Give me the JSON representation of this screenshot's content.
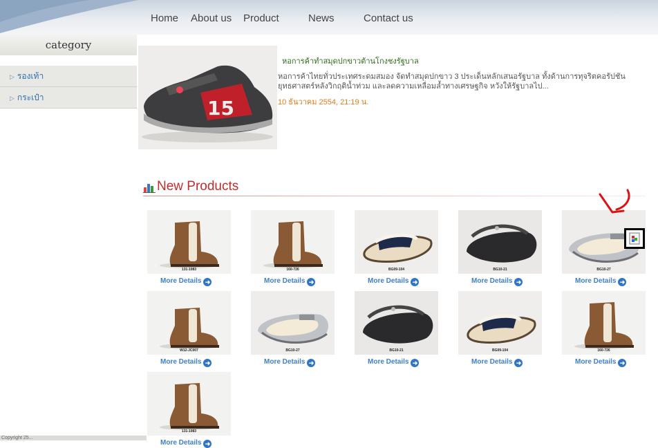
{
  "nav": {
    "home": "Home",
    "about": "About us",
    "product": "Product",
    "news": "News",
    "contact": "Contact us"
  },
  "sidebar": {
    "heading": "category",
    "items": [
      {
        "label": "รองเท้า"
      },
      {
        "label": "กระเป๋า"
      }
    ]
  },
  "news": {
    "title": "หอการค้าทำสมุดปกขาวต้านโกงชงรัฐบาล",
    "summary": "หอการค้าไทยทั่วประเทศระดมสมอง จัดทำสมุดปกขาว 3 ประเด็นหลักเสนอรัฐบาล ทั้งด้านการทุจริตคอรัปชัน ยุทธศาสตร์หลังวิกฤติน้ำท่วม และลดความเหลื่อมล้ำทางเศรษฐกิจ หวังให้รัฐบาลไป...",
    "date": "10 ธันวาคม 2554, 21:19 น.",
    "image_badge": "15"
  },
  "section": {
    "title": "New Products"
  },
  "more_label": "More Details",
  "products": [
    {
      "code": "131-1083",
      "kind": "boot"
    },
    {
      "code": "160-726",
      "kind": "boot"
    },
    {
      "code": "BG09-104",
      "kind": "sandal"
    },
    {
      "code": "BG10-21",
      "kind": "clog-black"
    },
    {
      "code": "BG10-27",
      "kind": "clog-silver"
    },
    {
      "code": "W12-JC007",
      "kind": "boot-short"
    },
    {
      "code": "BG10-27",
      "kind": "clog-silver"
    },
    {
      "code": "BG10-21",
      "kind": "clog-black"
    },
    {
      "code": "BG09-104",
      "kind": "sandal"
    },
    {
      "code": "160-726",
      "kind": "boot"
    },
    {
      "code": "131-1083",
      "kind": "boot"
    }
  ],
  "footer": {
    "text": "Copyright 25..."
  },
  "colors": {
    "nav_text": "#444444",
    "accent_red": "#c22d2d",
    "link_blue": "#3f7fc8",
    "date_orange": "#e07c1a",
    "news_green": "#2f6d1c"
  },
  "icons": {
    "section": "bar-chart-icon",
    "more": "arrow-right-circle-icon",
    "plugin": "missing-plugin-icon",
    "annotation": "red-arrow-icon"
  }
}
